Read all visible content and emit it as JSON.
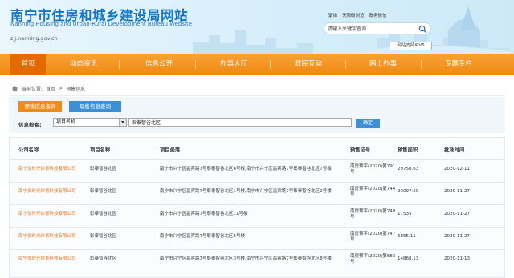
{
  "header": {
    "title": "南宁市住房和城乡建设局网站",
    "title_en": "Nanning Housing and Urban-Rural Development Bureau Website",
    "domain": "zjj.nanning.gov.cn",
    "top_links": [
      "繁体",
      "无障碍浏览",
      "政务微信"
    ],
    "search_placeholder": "请输入关键字查询",
    "ipv6_label": "网站支持IPV6"
  },
  "colors": {
    "brand_blue": "#1577c4",
    "nav_orange": "#f08914",
    "nav_active": "#e26a00",
    "accent_blue": "#3d90d8",
    "company_link": "#e2731c"
  },
  "nav": {
    "items": [
      "首页",
      "动态资讯",
      "信息公开",
      "办事大厅",
      "政民互动",
      "网上办事",
      "专题专栏"
    ]
  },
  "breadcrumb": {
    "prefix": "当前位置:",
    "home": "首页",
    "sep": ">",
    "current": "预售信息"
  },
  "filter": {
    "tabs": [
      "预售信息查询",
      "现售信息查询"
    ],
    "label": "信息检索:",
    "field_selected": "项目名称",
    "keyword": "彰泰智谷北区",
    "confirm_label": "确定"
  },
  "table": {
    "columns": [
      "公司名称",
      "项目名称",
      "项目坐落",
      "预售证号",
      "预售面积",
      "批准时间"
    ],
    "rows": [
      {
        "company": "南宁优时光体育科技有限公司",
        "project": "彰泰智谷北区",
        "location": "南宁市兴宁区邕宾路7号彰泰智谷北区6号楼,南宁市兴宁区邕宾路7号彰泰智谷北区7号楼",
        "cert": "南房预字(2020)第791号",
        "area": "29758.63",
        "date": "2020-12-11"
      },
      {
        "company": "南宁优时光体育科技有限公司",
        "project": "彰泰智谷北区",
        "location": "南宁市兴宁区邕宾路7号彰泰智谷北区1号楼,南宁市兴宁区邕宾路7号彰泰智谷北区2号楼",
        "cert": "南房预字(2020)第744号",
        "area": "23097.69",
        "date": "2020-11-27"
      },
      {
        "company": "南宁优时光体育科技有限公司",
        "project": "彰泰智谷北区",
        "location": "南宁市兴宁区邕宾路7号彰泰智谷北区11号楼",
        "cert": "南房预字(2020)第748号",
        "area": "17535",
        "date": "2020-11-27"
      },
      {
        "company": "南宁优时光体育科技有限公司",
        "project": "彰泰智谷北区",
        "location": "南宁市兴宁区邕宾路7号彰泰智谷北区5号楼",
        "cert": "南房预字(2020)第747号",
        "area": "6865.11",
        "date": "2020-11-27"
      },
      {
        "company": "南宁优时光体育科技有限公司",
        "project": "彰泰智谷北区",
        "location": "南宁市兴宁区邕宾路7号彰泰智谷北区3号楼,南宁市兴宁区邕宾路7号彰泰智谷北区8号楼",
        "cert": "南房预字(2020)第683号",
        "area": "14868.13",
        "date": "2020-11-13"
      }
    ]
  }
}
